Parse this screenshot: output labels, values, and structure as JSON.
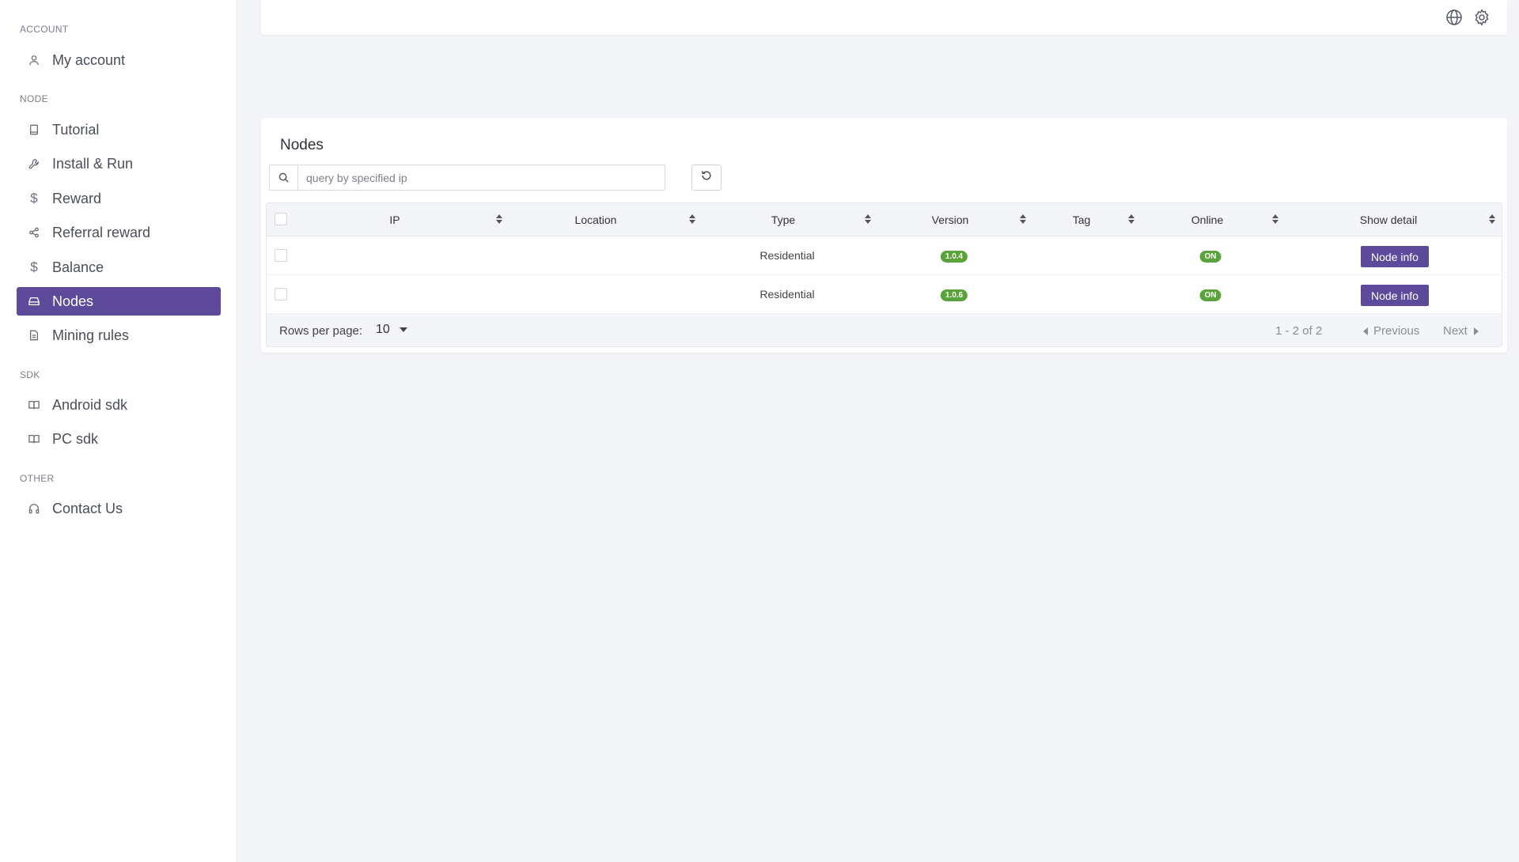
{
  "sidebar": {
    "sections": [
      {
        "label": "ACCOUNT",
        "items": [
          {
            "label": "My account",
            "icon": "user-icon"
          }
        ]
      },
      {
        "label": "NODE",
        "items": [
          {
            "label": "Tutorial",
            "icon": "book-icon"
          },
          {
            "label": "Install & Run",
            "icon": "wrench-icon"
          },
          {
            "label": "Reward",
            "icon": "dollar-icon"
          },
          {
            "label": "Referral reward",
            "icon": "share-icon"
          },
          {
            "label": "Balance",
            "icon": "dollar-icon"
          },
          {
            "label": "Nodes",
            "icon": "server-icon",
            "active": true
          },
          {
            "label": "Mining rules",
            "icon": "document-icon"
          }
        ]
      },
      {
        "label": "SDK",
        "items": [
          {
            "label": "Android sdk",
            "icon": "open-book-icon"
          },
          {
            "label": "PC sdk",
            "icon": "open-book-icon"
          }
        ]
      },
      {
        "label": "OTHER",
        "items": [
          {
            "label": "Contact Us",
            "icon": "headphones-icon"
          }
        ]
      }
    ]
  },
  "topbar": {
    "icons": [
      "globe-icon",
      "gear-icon"
    ]
  },
  "nodes": {
    "title": "Nodes",
    "search_placeholder": "query by specified ip",
    "columns": [
      "IP",
      "Location",
      "Type",
      "Version",
      "Tag",
      "Online",
      "Show detail"
    ],
    "rows": [
      {
        "ip": "",
        "location": "",
        "type": "Residential",
        "version": "1.0.4",
        "tag": "",
        "online": "ON",
        "action": "Node info"
      },
      {
        "ip": "",
        "location": "",
        "type": "Residential",
        "version": "1.0.6",
        "tag": "",
        "online": "ON",
        "action": "Node info"
      }
    ],
    "footer": {
      "rows_per_page_label": "Rows per page:",
      "rows_per_page_value": "10",
      "range": "1 - 2 of 2",
      "previous": "Previous",
      "next": "Next"
    }
  },
  "colors": {
    "accent": "#5e4a9a",
    "badge_green": "#5aa23a",
    "background": "#f4f5f9"
  }
}
